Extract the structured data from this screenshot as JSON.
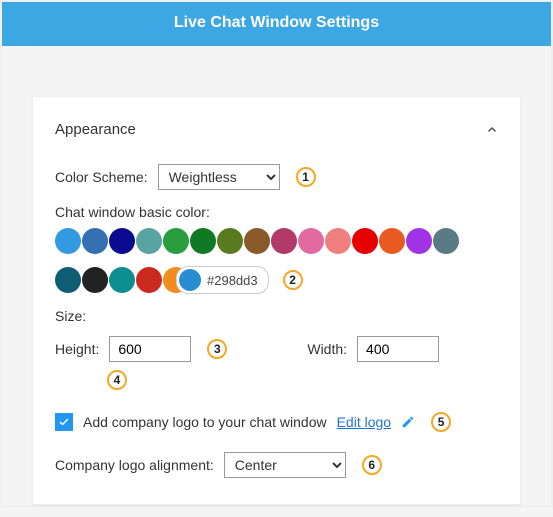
{
  "header": {
    "title": "Live Chat Window Settings"
  },
  "section": {
    "title": "Appearance",
    "colorSchemeLabel": "Color Scheme:",
    "colorSchemeValue": "Weightless",
    "basicColorLabel": "Chat window basic color:",
    "colors_row1": [
      "#3399e0",
      "#3471b3",
      "#0b0b8f",
      "#5aa3a3",
      "#2a9e3f",
      "#0f7a23",
      "#5a7a1f",
      "#8b5a2b",
      "#b23a6a",
      "#e26aa0",
      "#f08080",
      "#e60000",
      "#e85a1f",
      "#a033e6",
      "#5a7a85"
    ],
    "colors_row2": [
      "#0e5d73",
      "#222222",
      "#0d8f8f",
      "#cc2a1f",
      "#f28c1f"
    ],
    "selectedColor": "#298dd3",
    "selectedColorHex": "#298dd3",
    "sizeLabel": "Size:",
    "heightLabel": "Height:",
    "heightValue": "600",
    "widthLabel": "Width:",
    "widthValue": "400",
    "logoCheckboxLabel": "Add company logo to your chat window",
    "editLogoLabel": "Edit logo",
    "alignLabel": "Company logo alignment:",
    "alignValue": "Center"
  },
  "annot": {
    "a1": "1",
    "a2": "2",
    "a3": "3",
    "a4": "4",
    "a5": "5",
    "a6": "6"
  }
}
